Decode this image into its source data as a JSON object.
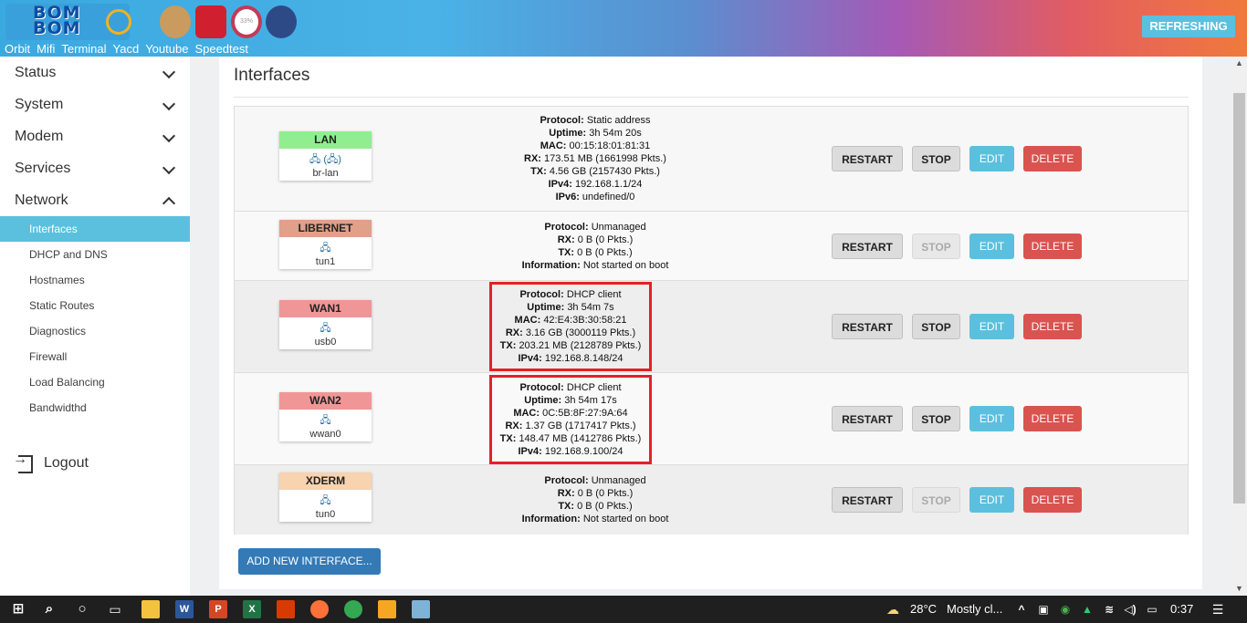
{
  "header": {
    "logo_text": "BOM BOM",
    "links": [
      "Orbit",
      "Mifi",
      "Terminal",
      "Yacd",
      "Youtube",
      "Speedtest"
    ],
    "refresh_label": "REFRESHING",
    "gauge_text": "33%"
  },
  "sidebar": {
    "menu": [
      {
        "label": "Status",
        "expanded": false
      },
      {
        "label": "System",
        "expanded": false
      },
      {
        "label": "Modem",
        "expanded": false
      },
      {
        "label": "Services",
        "expanded": false
      },
      {
        "label": "Network",
        "expanded": true
      }
    ],
    "subitems": [
      "Interfaces",
      "DHCP and DNS",
      "Hostnames",
      "Static Routes",
      "Diagnostics",
      "Firewall",
      "Load Balancing",
      "Bandwidthd"
    ],
    "active_subitem": "Interfaces",
    "logout_label": "Logout"
  },
  "main": {
    "title": "Interfaces",
    "buttons": {
      "restart": "RESTART",
      "stop": "STOP",
      "edit": "EDIT",
      "delete": "DELETE"
    },
    "add_label": "ADD NEW INTERFACE...",
    "interfaces": [
      {
        "name": "LAN",
        "color": "#90ee90",
        "device": "br-lan",
        "icon": "bridge-icon",
        "info": [
          {
            "k": "Protocol:",
            "v": "Static address"
          },
          {
            "k": "Uptime:",
            "v": "3h 54m 20s"
          },
          {
            "k": "MAC:",
            "v": "00:15:18:01:81:31"
          },
          {
            "k": "RX:",
            "v": "173.51 MB (1661998 Pkts.)"
          },
          {
            "k": "TX:",
            "v": "4.56 GB (2157430 Pkts.)"
          },
          {
            "k": "IPv4:",
            "v": "192.168.1.1/24"
          },
          {
            "k": "IPv6:",
            "v": "undefined/0"
          }
        ],
        "stop_disabled": false,
        "highlighted": false
      },
      {
        "name": "LIBERNET",
        "color": "#e0a08a",
        "device": "tun1",
        "icon": "ethernet-icon",
        "info": [
          {
            "k": "Protocol:",
            "v": "Unmanaged"
          },
          {
            "k": "RX:",
            "v": "0 B (0 Pkts.)"
          },
          {
            "k": "TX:",
            "v": "0 B (0 Pkts.)"
          },
          {
            "k": "Information:",
            "v": "Not started on boot"
          }
        ],
        "stop_disabled": true,
        "highlighted": false
      },
      {
        "name": "WAN1",
        "color": "#f09696",
        "device": "usb0",
        "icon": "ethernet-icon",
        "info": [
          {
            "k": "Protocol:",
            "v": "DHCP client"
          },
          {
            "k": "Uptime:",
            "v": "3h 54m 7s"
          },
          {
            "k": "MAC:",
            "v": "42:E4:3B:30:58:21"
          },
          {
            "k": "RX:",
            "v": "3.16 GB (3000119 Pkts.)"
          },
          {
            "k": "TX:",
            "v": "203.21 MB (2128789 Pkts.)"
          },
          {
            "k": "IPv4:",
            "v": "192.168.8.148/24"
          }
        ],
        "stop_disabled": false,
        "highlighted": true
      },
      {
        "name": "WAN2",
        "color": "#f09696",
        "device": "wwan0",
        "icon": "ethernet-icon",
        "info": [
          {
            "k": "Protocol:",
            "v": "DHCP client"
          },
          {
            "k": "Uptime:",
            "v": "3h 54m 17s"
          },
          {
            "k": "MAC:",
            "v": "0C:5B:8F:27:9A:64"
          },
          {
            "k": "RX:",
            "v": "1.37 GB (1717417 Pkts.)"
          },
          {
            "k": "TX:",
            "v": "148.47 MB (1412786 Pkts.)"
          },
          {
            "k": "IPv4:",
            "v": "192.168.9.100/24"
          }
        ],
        "stop_disabled": false,
        "highlighted": true
      },
      {
        "name": "XDERM",
        "color": "#f7d3b0",
        "device": "tun0",
        "icon": "ethernet-icon",
        "info": [
          {
            "k": "Protocol:",
            "v": "Unmanaged"
          },
          {
            "k": "RX:",
            "v": "0 B (0 Pkts.)"
          },
          {
            "k": "TX:",
            "v": "0 B (0 Pkts.)"
          },
          {
            "k": "Information:",
            "v": "Not started on boot"
          }
        ],
        "stop_disabled": true,
        "highlighted": false
      }
    ]
  },
  "taskbar": {
    "temperature": "28°C",
    "weather": "Mostly cl...",
    "time": "0:37"
  }
}
